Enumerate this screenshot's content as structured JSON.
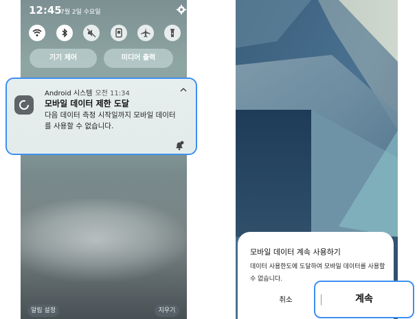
{
  "left": {
    "status_bar": {
      "time": "12:45",
      "date": "7월 2일 수요일"
    },
    "quick_settings": [
      {
        "icon": "wifi-icon",
        "on": true
      },
      {
        "icon": "bluetooth-icon",
        "on": true
      },
      {
        "icon": "mute-icon",
        "on": false
      },
      {
        "icon": "portrait-lock-icon",
        "on": false
      },
      {
        "icon": "airplane-icon",
        "on": false
      },
      {
        "icon": "flashlight-icon",
        "on": false
      }
    ],
    "device_control_label": "기기 제어",
    "media_output_label": "미디어 출력",
    "notification": {
      "app_name": "Android 시스템",
      "time": "오전 11:34",
      "title": "모바일 데이터 제한 도달",
      "body": "다음 데이터 측정 시작일까지 모바일 데이터를 사용할 수 없습니다."
    },
    "notification_settings_label": "알림 설정",
    "clear_label": "지우기"
  },
  "right": {
    "dialog": {
      "title": "모바일 데이터 계속 사용하기",
      "body": "데이터 사용한도에 도달하여 모바일 데이터를 사용할 수 없습니다.",
      "cancel_label": "취소",
      "continue_label": "계속"
    }
  },
  "colors": {
    "highlight": "#3d8ef0",
    "panel_bg": "#e6eeee"
  }
}
